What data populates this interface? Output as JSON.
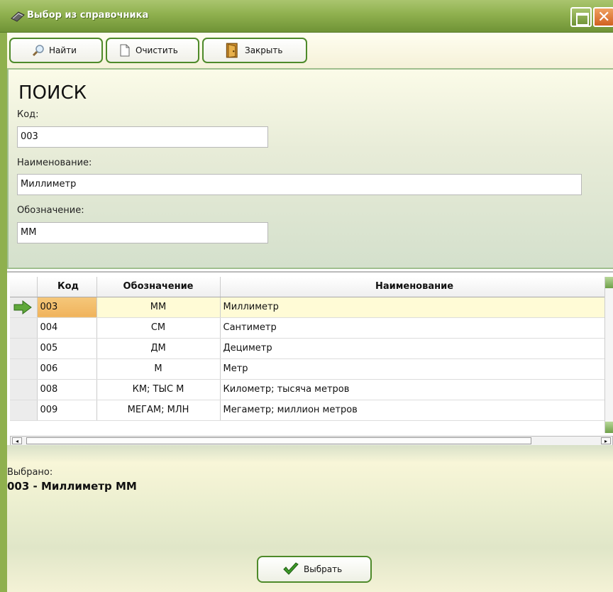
{
  "window": {
    "title": "Выбор из справочника"
  },
  "toolbar": {
    "find": "Найти",
    "clear": "Очистить",
    "close": "Закрыть"
  },
  "search": {
    "heading": "ПОИСК",
    "code_label": "Код:",
    "code_value": "003",
    "name_label": "Наименование:",
    "name_value": "Миллиметр",
    "abbr_label": "Обозначение:",
    "abbr_value": "ММ"
  },
  "grid": {
    "headers": {
      "code": "Код",
      "abbr": "Обозначение",
      "name": "Наименование"
    },
    "rows": [
      {
        "code": "003",
        "abbr": "ММ",
        "name": "Миллиметр"
      },
      {
        "code": "004",
        "abbr": "СМ",
        "name": "Сантиметр"
      },
      {
        "code": "005",
        "abbr": "ДМ",
        "name": "Дециметр"
      },
      {
        "code": "006",
        "abbr": "М",
        "name": "Метр"
      },
      {
        "code": "008",
        "abbr": "КМ; ТЫС М",
        "name": "Километр; тысяча метров"
      },
      {
        "code": "009",
        "abbr": "МЕГАМ; МЛН",
        "name": "Мегаметр; миллион метров"
      }
    ]
  },
  "selection": {
    "label": "Выбрано:",
    "value": "003 - Миллиметр ММ"
  },
  "footer": {
    "choose": "Выбрать"
  }
}
